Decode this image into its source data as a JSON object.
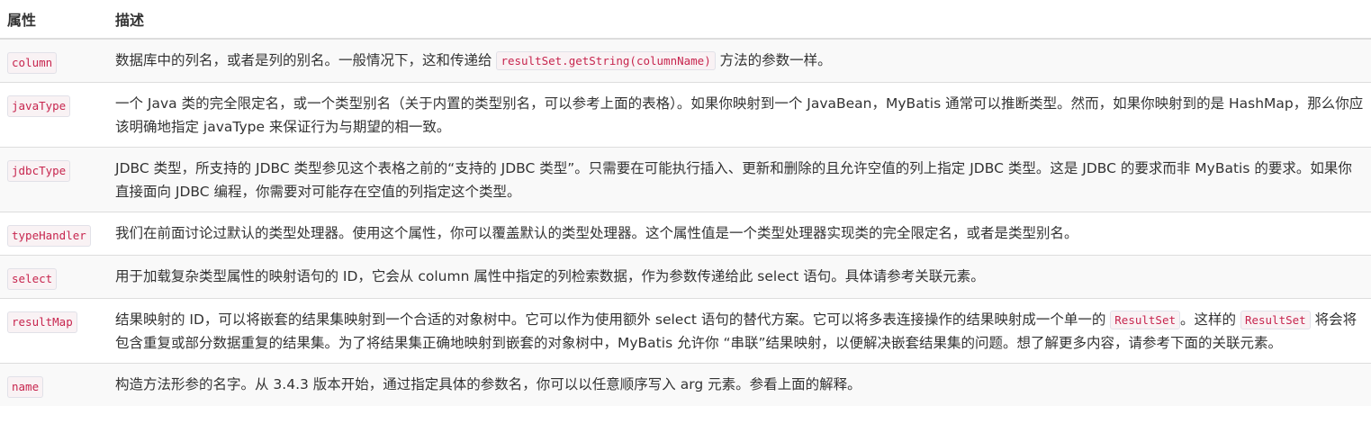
{
  "header": {
    "col_attr": "属性",
    "col_desc": "描述"
  },
  "rows": [
    {
      "attr": "column",
      "desc": [
        {
          "t": "数据库中的列名，或者是列的别名。一般情况下，这和传递给 "
        },
        {
          "c": "resultSet.getString(columnName)"
        },
        {
          "t": " 方法的参数一样。"
        }
      ]
    },
    {
      "attr": "javaType",
      "desc": [
        {
          "t": "一个 Java 类的完全限定名，或一个类型别名（关于内置的类型别名，可以参考上面的表格）。如果你映射到一个 JavaBean，MyBatis 通常可以推断类型。然而，如果你映射到的是 HashMap，那么你应该明确地指定 javaType 来保证行为与期望的相一致。"
        }
      ]
    },
    {
      "attr": "jdbcType",
      "desc": [
        {
          "t": "JDBC 类型，所支持的 JDBC 类型参见这个表格之前的“支持的 JDBC 类型”。只需要在可能执行插入、更新和删除的且允许空值的列上指定 JDBC 类型。这是 JDBC 的要求而非 MyBatis 的要求。如果你直接面向 JDBC 编程，你需要对可能存在空值的列指定这个类型。"
        }
      ]
    },
    {
      "attr": "typeHandler",
      "desc": [
        {
          "t": "我们在前面讨论过默认的类型处理器。使用这个属性，你可以覆盖默认的类型处理器。这个属性值是一个类型处理器实现类的完全限定名，或者是类型别名。"
        }
      ]
    },
    {
      "attr": "select",
      "desc": [
        {
          "t": "用于加载复杂类型属性的映射语句的 ID，它会从 column 属性中指定的列检索数据，作为参数传递给此 select 语句。具体请参考关联元素。"
        }
      ]
    },
    {
      "attr": "resultMap",
      "desc": [
        {
          "t": "结果映射的 ID，可以将嵌套的结果集映射到一个合适的对象树中。它可以作为使用额外 select 语句的替代方案。它可以将多表连接操作的结果映射成一个单一的 "
        },
        {
          "c": "ResultSet"
        },
        {
          "t": "。这样的 "
        },
        {
          "c": "ResultSet"
        },
        {
          "t": " 将会将包含重复或部分数据重复的结果集。为了将结果集正确地映射到嵌套的对象树中，MyBatis 允许你 “串联”结果映射，以便解决嵌套结果集的问题。想了解更多内容，请参考下面的关联元素。"
        }
      ]
    },
    {
      "attr": "name",
      "desc": [
        {
          "t": "构造方法形参的名字。从 3.4.3 版本开始，通过指定具体的参数名，你可以以任意顺序写入 arg 元素。参看上面的解释。"
        }
      ]
    }
  ]
}
